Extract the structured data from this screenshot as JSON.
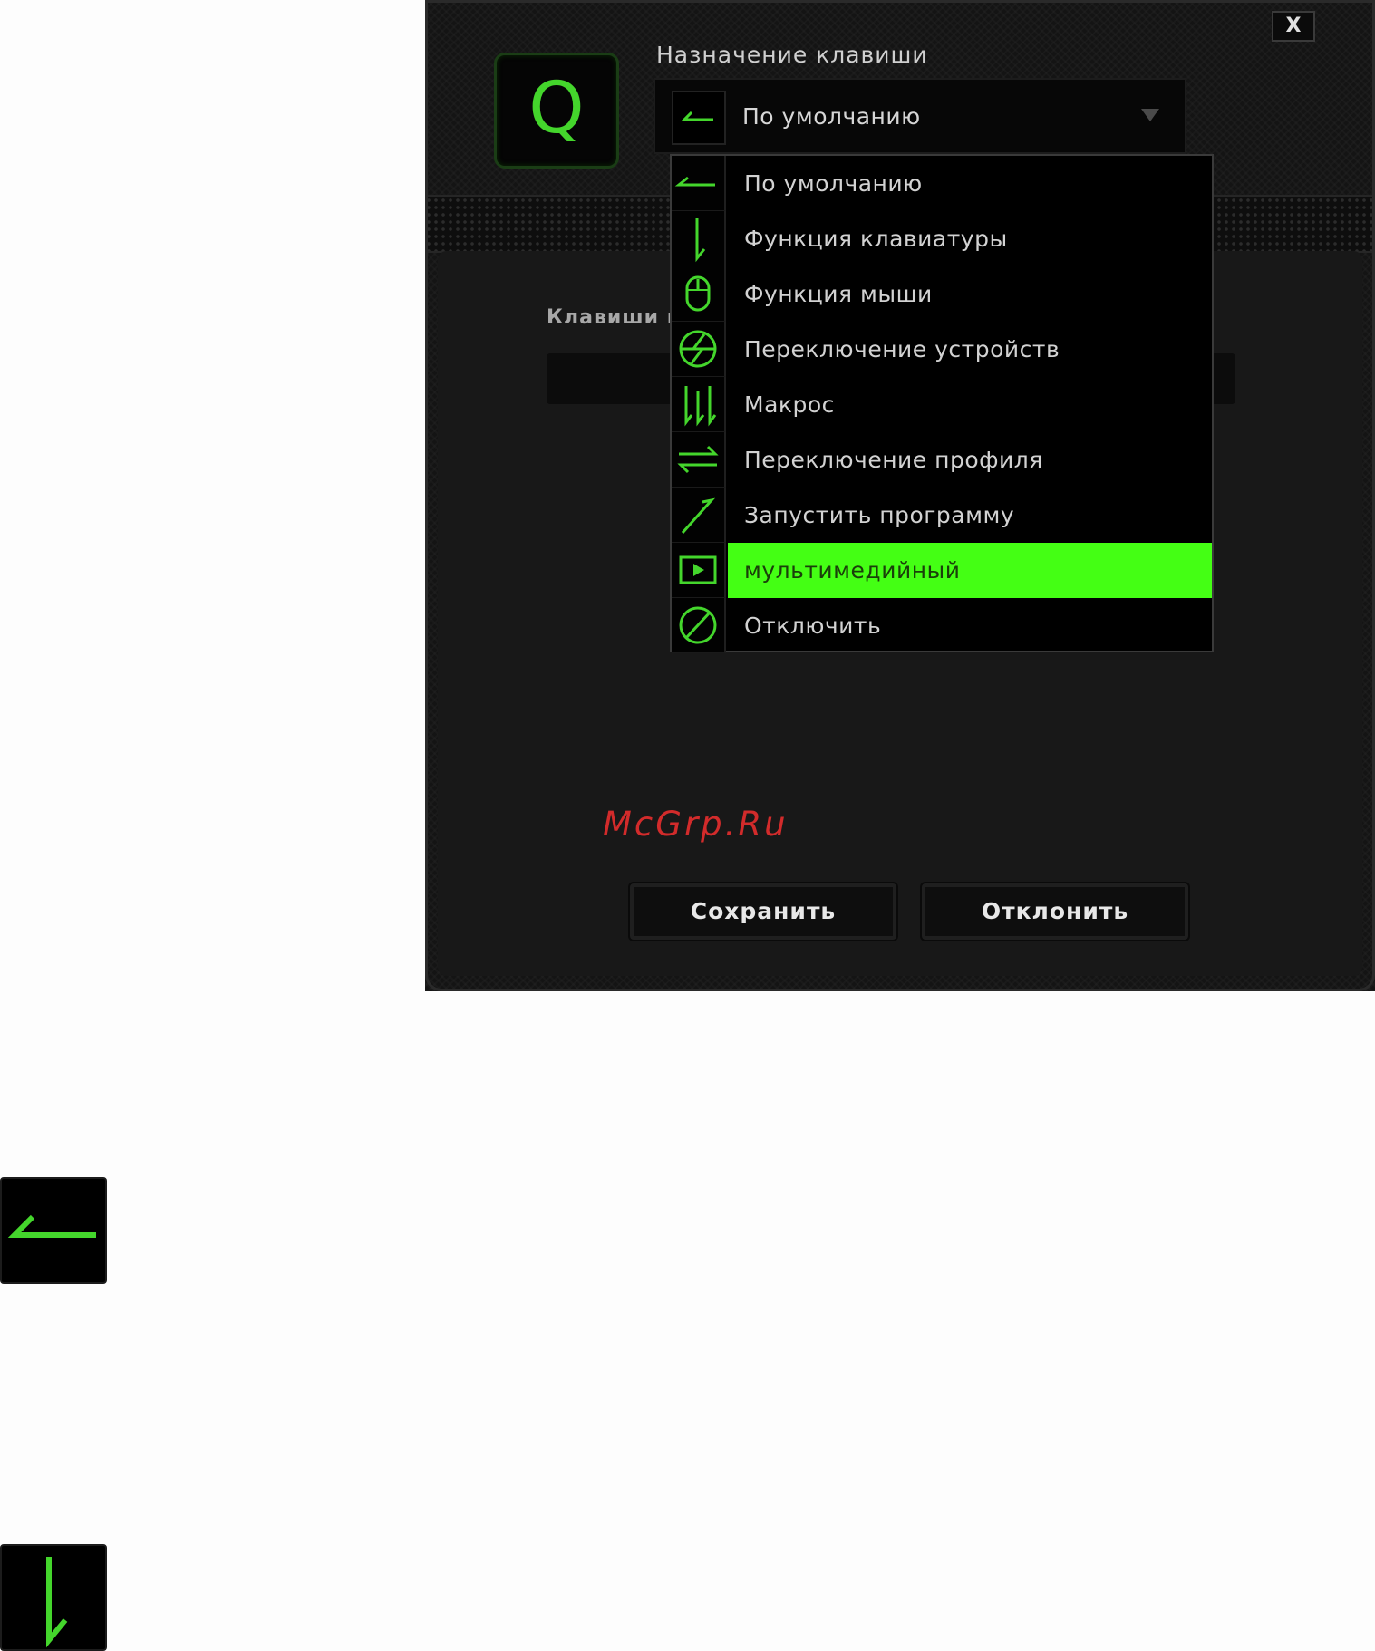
{
  "dialog": {
    "close_label": "X",
    "key_letter": "Q",
    "assign_label": "Назначение клавиши",
    "selected_value": "По умолчанию",
    "keys_label": "Клавиши п",
    "accent_color": "#44d62c",
    "highlight_color": "#44ff14"
  },
  "dropdown": {
    "items": [
      {
        "label": "По умолчанию",
        "icon": "default-arrow-icon"
      },
      {
        "label": "Функция клавиатуры",
        "icon": "keyboard-function-icon"
      },
      {
        "label": "Функция мыши",
        "icon": "mouse-icon"
      },
      {
        "label": "Переключение устройств",
        "icon": "device-switch-icon"
      },
      {
        "label": "Макрос",
        "icon": "macro-icon"
      },
      {
        "label": "Переключение профиля",
        "icon": "profile-switch-icon"
      },
      {
        "label": "Запустить программу",
        "icon": "launch-program-icon"
      },
      {
        "label": "мультимедийный",
        "icon": "multimedia-icon"
      },
      {
        "label": "Отключить",
        "icon": "disable-icon"
      }
    ],
    "selected_index": 7
  },
  "buttons": {
    "save": "Сохранить",
    "reject": "Отклонить"
  },
  "watermark": "McGrp.Ru",
  "standalone_icons": [
    "default-arrow-icon",
    "keyboard-function-icon"
  ]
}
